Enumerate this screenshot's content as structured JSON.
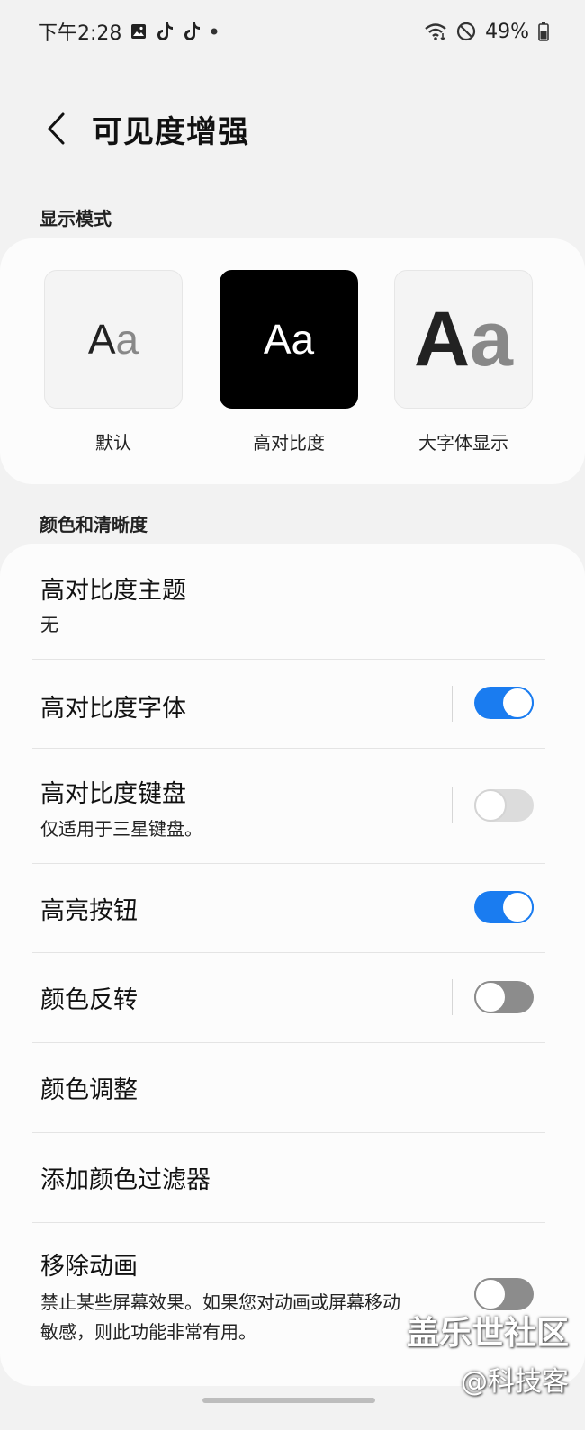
{
  "status_bar": {
    "time": "下午2:28",
    "battery": "49%",
    "left_icons": [
      "gallery-icon",
      "tiktok-icon",
      "tiktok-icon",
      "dot-icon"
    ],
    "right_icons": [
      "wifi-icon",
      "do-not-disturb-icon",
      "battery-icon"
    ]
  },
  "header": {
    "title": "可见度增强"
  },
  "display_mode": {
    "section_label": "显示模式",
    "options": [
      {
        "preview": "Aa",
        "label": "默认"
      },
      {
        "preview": "Aa",
        "label": "高对比度"
      },
      {
        "preview": "Aa",
        "label": "大字体显示"
      }
    ]
  },
  "color_clarity": {
    "section_label": "颜色和清晰度",
    "items": [
      {
        "title": "高对比度主题",
        "subtitle": "无"
      },
      {
        "title": "高对比度字体",
        "toggle": "on"
      },
      {
        "title": "高对比度键盘",
        "subtitle": "仅适用于三星键盘。",
        "toggle": "disabled"
      },
      {
        "title": "高亮按钮",
        "toggle": "on"
      },
      {
        "title": "颜色反转",
        "toggle": "off"
      },
      {
        "title": "颜色调整"
      },
      {
        "title": "添加颜色过滤器"
      },
      {
        "title": "移除动画",
        "subtitle_line1": "禁止某些屏幕效果。如果您对动画或屏幕移动",
        "subtitle_line2": "敏感，则此功能非常有用。",
        "toggle": "off"
      }
    ]
  },
  "watermark": {
    "line1": "盖乐世社区",
    "line2": "@科技客"
  },
  "colors": {
    "accent": "#1a7cf0",
    "background": "#f2f2f2",
    "card": "#fcfcfc"
  }
}
